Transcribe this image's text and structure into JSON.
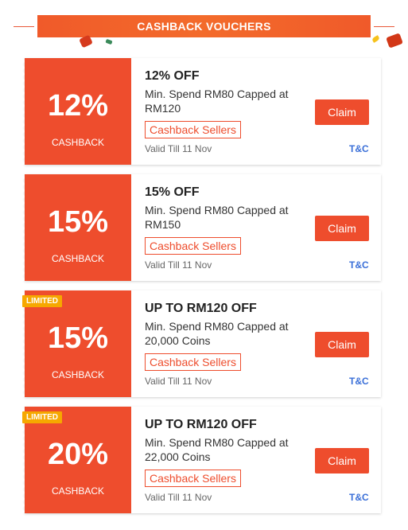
{
  "banner": {
    "title": "CASHBACK VOUCHERS"
  },
  "vouchers": [
    {
      "badge": "",
      "percent": "12%",
      "cashback_label": "CASHBACK",
      "title": "12% OFF",
      "description": "Min. Spend RM80 Capped at RM120",
      "tag": "Cashback Sellers",
      "valid": "Valid Till 11 Nov",
      "claim_label": "Claim",
      "tnc_label": "T&C"
    },
    {
      "badge": "",
      "percent": "15%",
      "cashback_label": "CASHBACK",
      "title": "15% OFF",
      "description": "Min. Spend RM80 Capped at RM150",
      "tag": "Cashback Sellers",
      "valid": "Valid Till 11 Nov",
      "claim_label": "Claim",
      "tnc_label": "T&C"
    },
    {
      "badge": "LIMITED",
      "percent": "15%",
      "cashback_label": "CASHBACK",
      "title": "UP TO RM120 OFF",
      "description": "Min. Spend RM80 Capped at 20,000 Coins",
      "tag": "Cashback Sellers",
      "valid": "Valid Till 11 Nov",
      "claim_label": "Claim",
      "tnc_label": "T&C"
    },
    {
      "badge": "LIMITED",
      "percent": "20%",
      "cashback_label": "CASHBACK",
      "title": "UP TO RM120 OFF",
      "description": "Min. Spend RM80 Capped at 22,000 Coins",
      "tag": "Cashback Sellers",
      "valid": "Valid Till 11 Nov",
      "claim_label": "Claim",
      "tnc_label": "T&C"
    }
  ],
  "colors": {
    "brand_orange": "#ee4d2d",
    "limited_badge": "#f6a800",
    "tnc_link": "#3a6fd8"
  }
}
